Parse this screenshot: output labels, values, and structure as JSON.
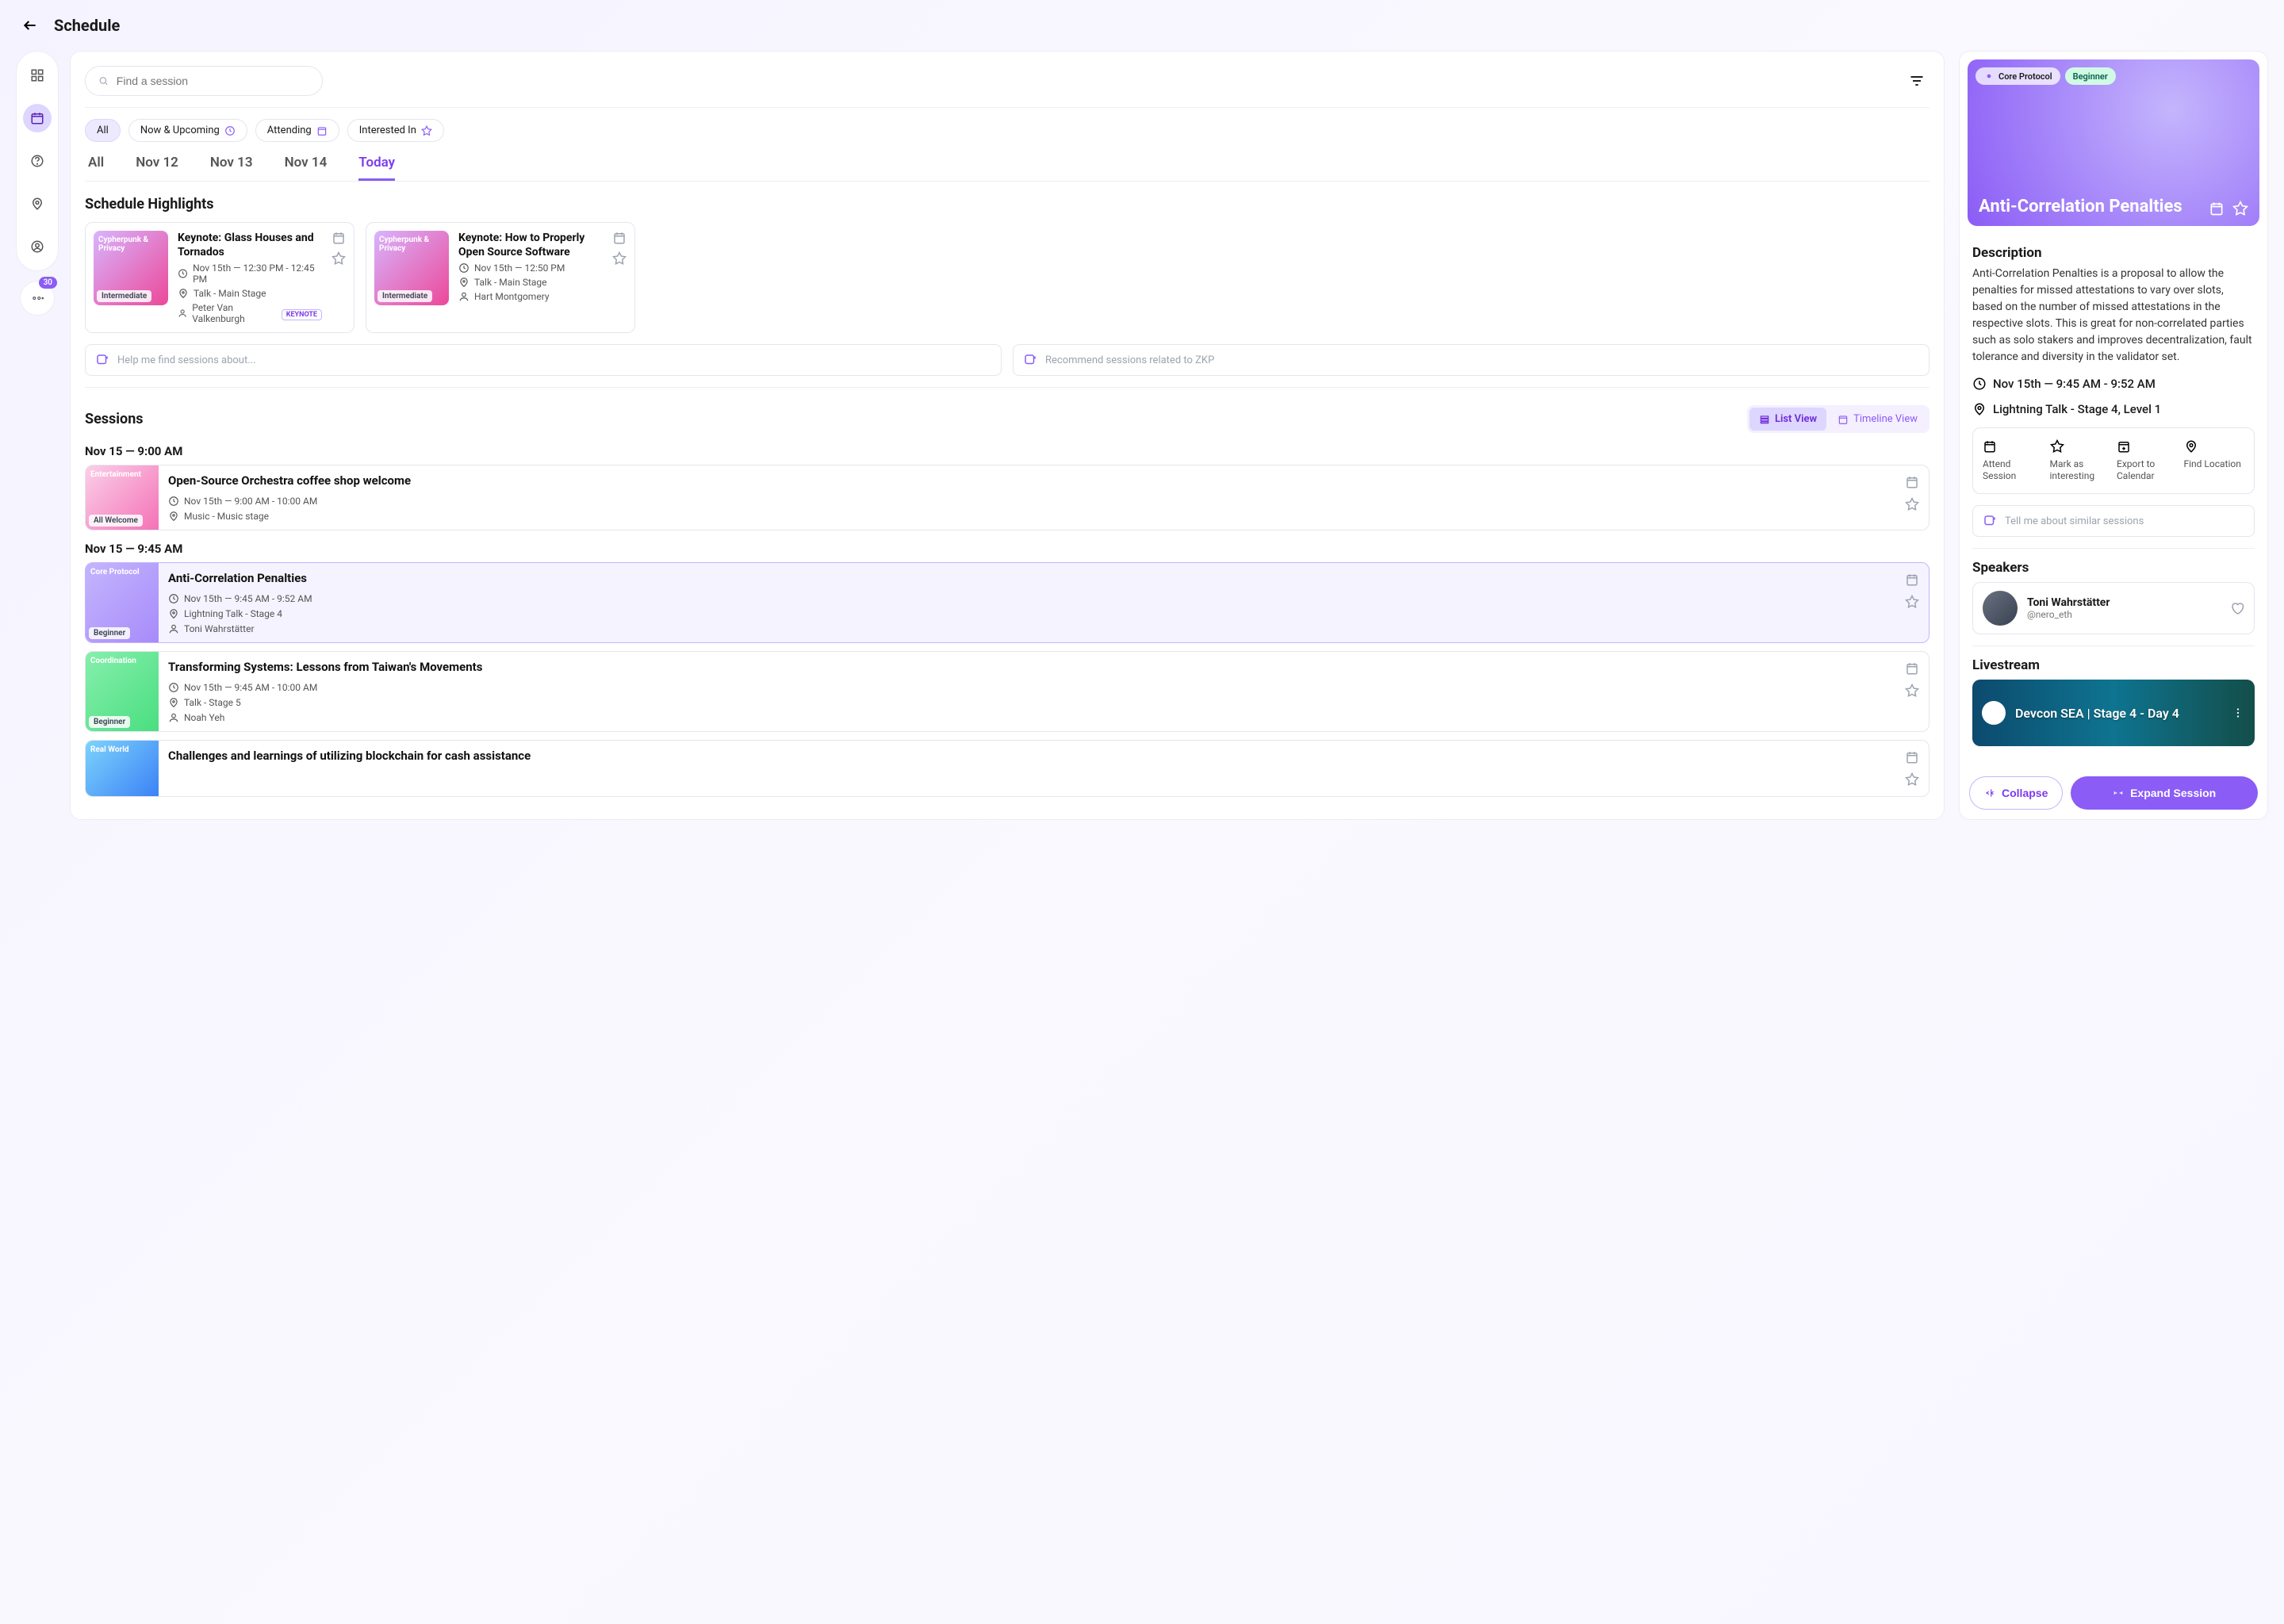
{
  "header": {
    "title": "Schedule"
  },
  "sidebar": {
    "notif_count": "30"
  },
  "search": {
    "placeholder": "Find a session"
  },
  "filters": {
    "all": "All",
    "now": "Now & Upcoming",
    "attending": "Attending",
    "interested": "Interested In"
  },
  "date_tabs": {
    "all": "All",
    "d1": "Nov 12",
    "d2": "Nov 13",
    "d3": "Nov 14",
    "today": "Today"
  },
  "highlights": {
    "title": "Schedule Highlights",
    "cards": [
      {
        "track": "Cypherpunk & Privacy",
        "level": "Intermediate",
        "title": "Keynote: Glass Houses and Tornados",
        "time": "Nov 15th — 12:30 PM - 12:45 PM",
        "venue": "Talk - Main Stage",
        "speaker": "Peter Van Valkenburgh",
        "badge": "KEYNOTE"
      },
      {
        "track": "Cypherpunk & Privacy",
        "level": "Intermediate",
        "title": "Keynote: How to Properly Open Source Software",
        "time": "Nov 15th — 12:50 PM",
        "venue": "Talk - Main Stage",
        "speaker": "Hart Montgomery",
        "badge": ""
      }
    ]
  },
  "suggestions": {
    "a": "Help me find sessions about...",
    "b": "Recommend sessions related to ZKP"
  },
  "sessions": {
    "title": "Sessions",
    "views": {
      "list": "List View",
      "timeline": "Timeline View"
    },
    "groups": [
      {
        "time_header": "Nov 15 — 9:00 AM",
        "items": [
          {
            "track": "Entertainment",
            "level": "All Welcome",
            "title": "Open-Source Orchestra coffee shop welcome",
            "time": "Nov 15th — 9:00 AM - 10:00 AM",
            "venue": "Music - Music stage",
            "speaker": "",
            "thumb_class": "entertainment",
            "selected": false
          }
        ]
      },
      {
        "time_header": "Nov 15 — 9:45 AM",
        "items": [
          {
            "track": "Core Protocol",
            "level": "Beginner",
            "title": "Anti-Correlation Penalties",
            "time": "Nov 15th — 9:45 AM - 9:52 AM",
            "venue": "Lightning Talk - Stage 4",
            "speaker": "Toni Wahrstätter",
            "thumb_class": "",
            "selected": true
          },
          {
            "track": "Coordination",
            "level": "Beginner",
            "title": "Transforming Systems: Lessons from Taiwan's Movements",
            "time": "Nov 15th — 9:45 AM - 10:00 AM",
            "venue": "Talk - Stage 5",
            "speaker": "Noah Yeh",
            "thumb_class": "coordination",
            "selected": false
          },
          {
            "track": "Real World",
            "level": "",
            "title": "Challenges and learnings of utilizing blockchain for cash assistance",
            "time": "",
            "venue": "",
            "speaker": "",
            "thumb_class": "realworld",
            "selected": false
          }
        ]
      }
    ]
  },
  "detail": {
    "track": "Core Protocol",
    "level": "Beginner",
    "title": "Anti-Correlation Penalties",
    "desc_title": "Description",
    "description": "Anti-Correlation Penalties is a proposal to allow the penalties for missed attestations to vary over slots, based on the number of missed attestations in the respective slots. This is great for non-correlated parties such as solo stakers and improves decentralization, fault tolerance and diversity in the validator set.",
    "time": "Nov 15th — 9:45 AM - 9:52 AM",
    "venue": "Lightning Talk - Stage 4, Level 1",
    "actions": {
      "attend": "Attend Session",
      "interesting": "Mark as interesting",
      "export": "Export to Calendar",
      "find": "Find Location"
    },
    "similar": "Tell me about similar sessions",
    "speakers_title": "Speakers",
    "speaker": {
      "name": "Toni Wahrstätter",
      "handle": "@nero_eth"
    },
    "livestream_title": "Livestream",
    "livestream_label": "Devcon SEA | Stage 4 - Day 4",
    "collapse": "Collapse",
    "expand": "Expand Session"
  }
}
